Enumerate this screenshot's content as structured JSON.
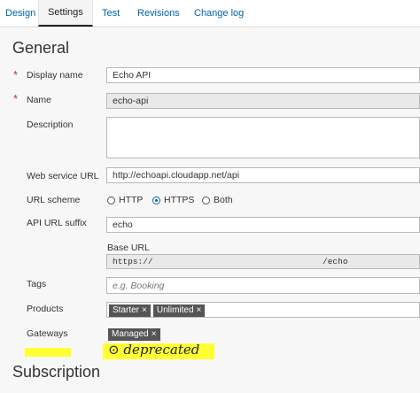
{
  "tabs": [
    "Design",
    "Settings",
    "Test",
    "Revisions",
    "Change log"
  ],
  "active_tab": "Settings",
  "section_general": "General",
  "fields": {
    "display_name": {
      "label": "Display name",
      "value": "Echo API"
    },
    "name": {
      "label": "Name",
      "value": "echo-api"
    },
    "description": {
      "label": "Description",
      "value": ""
    },
    "web_service_url": {
      "label": "Web service URL",
      "value": "http://echoapi.cloudapp.net/api"
    },
    "url_scheme": {
      "label": "URL scheme",
      "options": [
        "HTTP",
        "HTTPS",
        "Both"
      ],
      "selected": "HTTPS"
    },
    "api_url_suffix": {
      "label": "API URL suffix",
      "value": "echo"
    },
    "base_url": {
      "label": "Base URL",
      "prefix": "https://",
      "suffix": "/echo"
    },
    "tags": {
      "label": "Tags",
      "placeholder": "e.g. Booking"
    },
    "products": {
      "label": "Products",
      "chips": [
        "Starter",
        "Unlimited"
      ]
    },
    "gateways": {
      "label": "Gateways",
      "chips": [
        "Managed"
      ]
    }
  },
  "annotation_text": "deprecated",
  "section_subscription": "Subscription",
  "colors": {
    "link": "#0062ad",
    "required": "#c0392b",
    "chip_bg": "#555555",
    "highlight": "#ffff33"
  }
}
